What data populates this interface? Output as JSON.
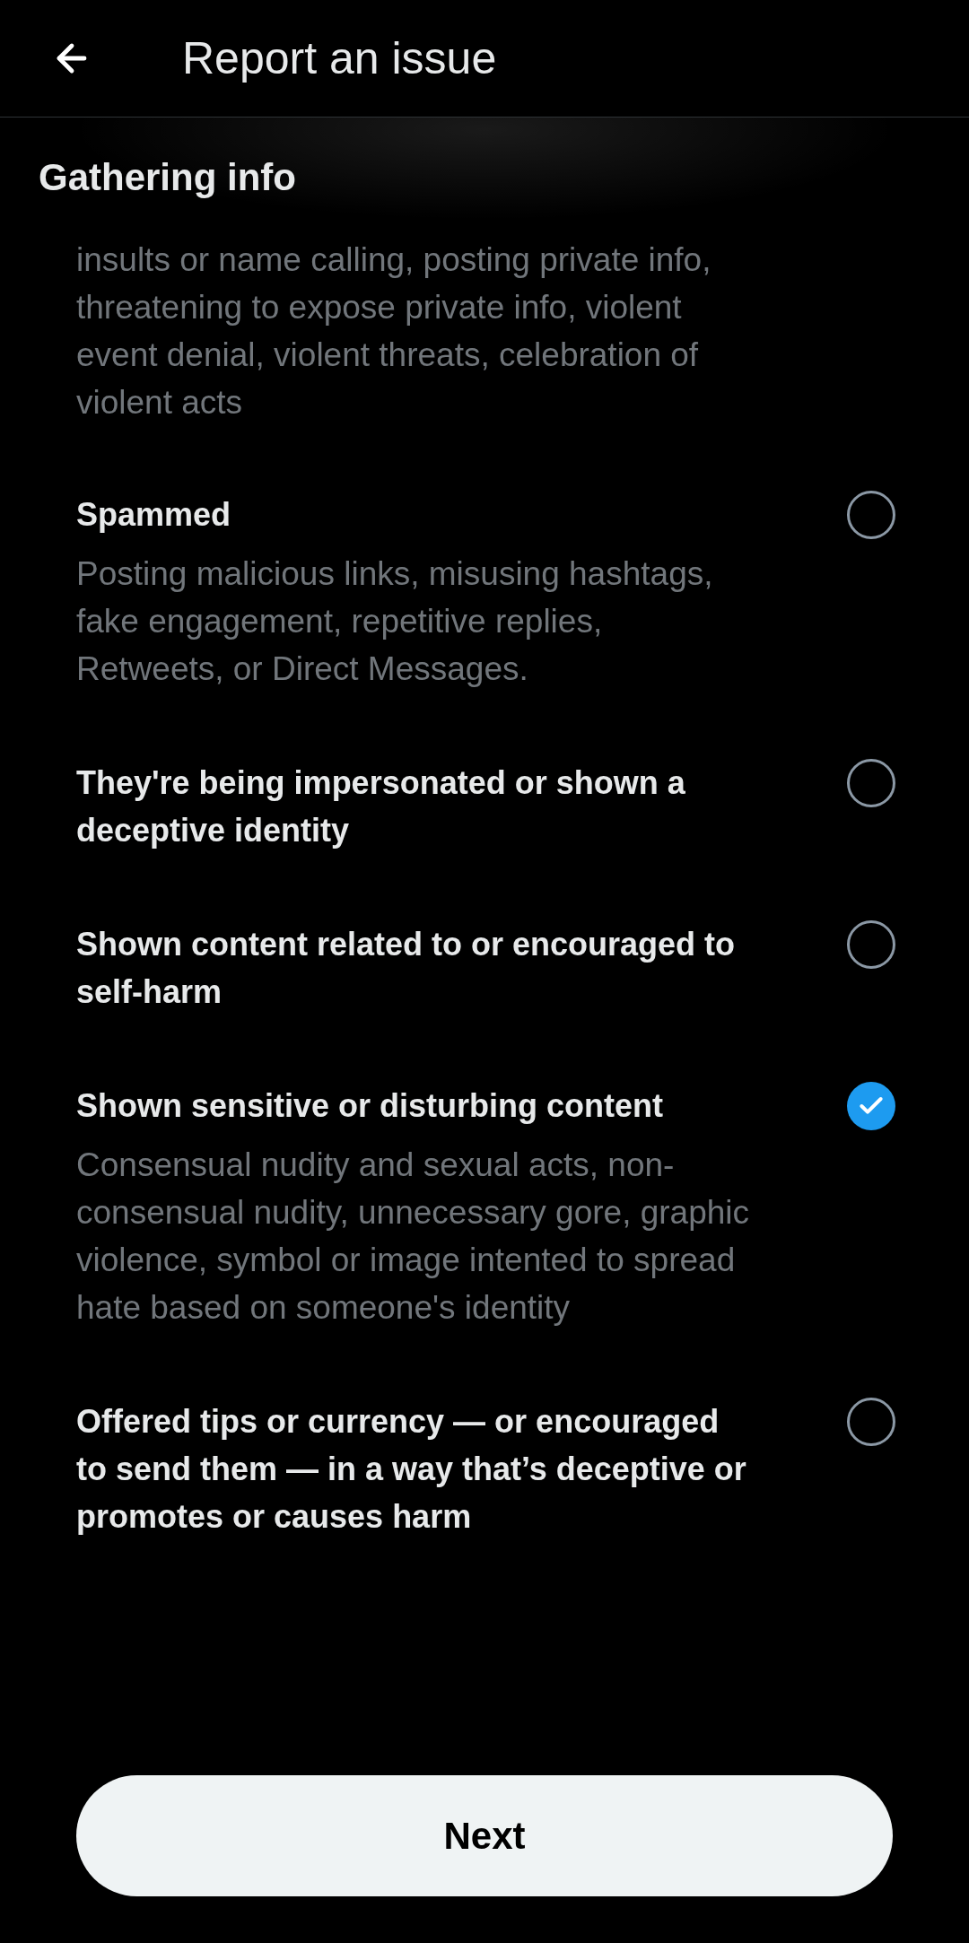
{
  "header": {
    "title": "Report an issue"
  },
  "section_title": "Gathering info",
  "continued_description": "insults or name calling, posting private info, threatening to expose private info, violent event denial, violent threats, celebration of violent acts",
  "options": [
    {
      "title": "Spammed",
      "description": "Posting malicious links, misusing hashtags, fake engagement, repetitive replies, Retweets, or Direct Messages.",
      "selected": false
    },
    {
      "title": "They're being impersonated or shown a deceptive identity",
      "selected": false
    },
    {
      "title": "Shown content related to or encouraged to self-harm",
      "selected": false
    },
    {
      "title": "Shown sensitive or disturbing content",
      "description": "Consensual nudity and sexual acts, non-consensual nudity, unnecessary gore, graphic violence, symbol or image intented to spread hate based on someone's identity",
      "selected": true
    },
    {
      "title": "Offered tips or currency — or encouraged to send them — in a way that’s deceptive or promotes or causes harm",
      "selected": false
    }
  ],
  "next_button": "Next"
}
